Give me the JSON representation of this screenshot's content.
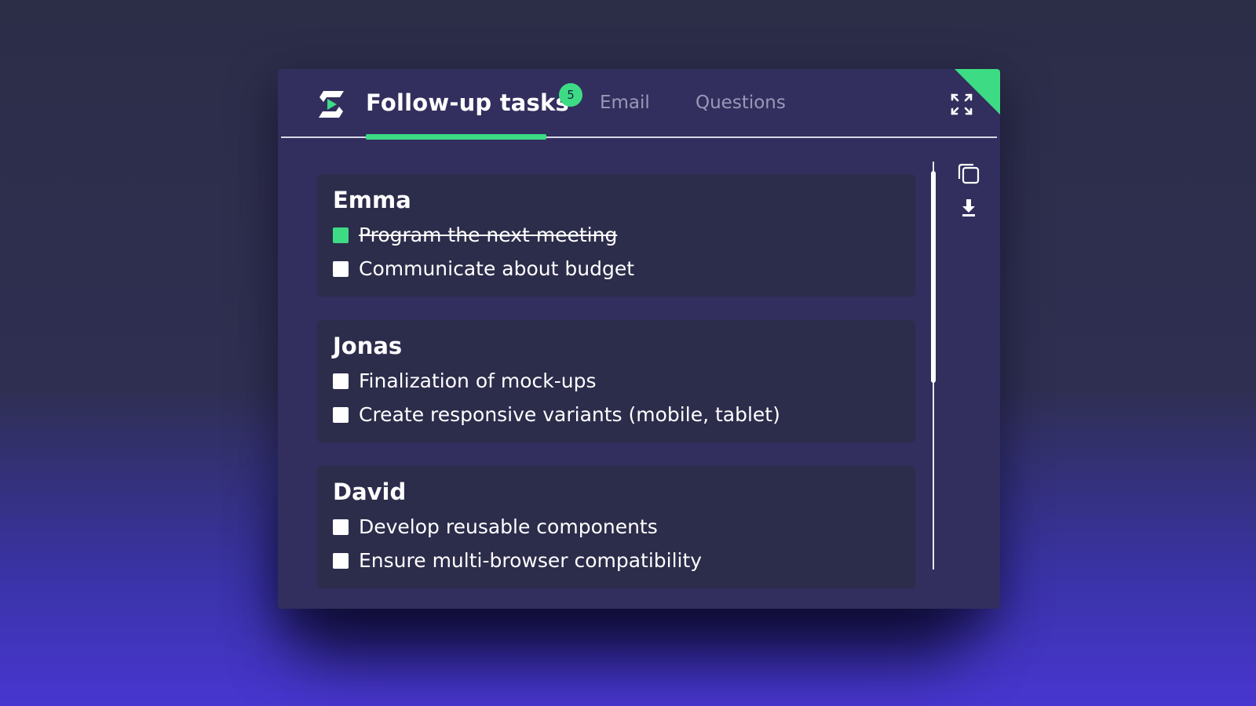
{
  "header": {
    "active_tab": "Follow-up tasks",
    "badge_count": "5",
    "tabs": [
      {
        "label": "Email"
      },
      {
        "label": "Questions"
      }
    ]
  },
  "icons": {
    "logo": "app-logo-icon",
    "expand": "expand-icon",
    "copy": "copy-icon",
    "download": "download-icon"
  },
  "colors": {
    "accent": "#3ddc84",
    "panel": "#322f5e",
    "card": "#2c2c4b"
  },
  "cards": [
    {
      "name": "Emma",
      "tasks": [
        {
          "text": "Program the next meeting",
          "done": true
        },
        {
          "text": "Communicate about budget",
          "done": false
        }
      ]
    },
    {
      "name": "Jonas",
      "tasks": [
        {
          "text": "Finalization of mock-ups",
          "done": false
        },
        {
          "text": "Create responsive variants (mobile, tablet)",
          "done": false
        }
      ]
    },
    {
      "name": "David",
      "tasks": [
        {
          "text": "Develop reusable components",
          "done": false
        },
        {
          "text": "Ensure multi-browser compatibility",
          "done": false
        }
      ]
    }
  ]
}
